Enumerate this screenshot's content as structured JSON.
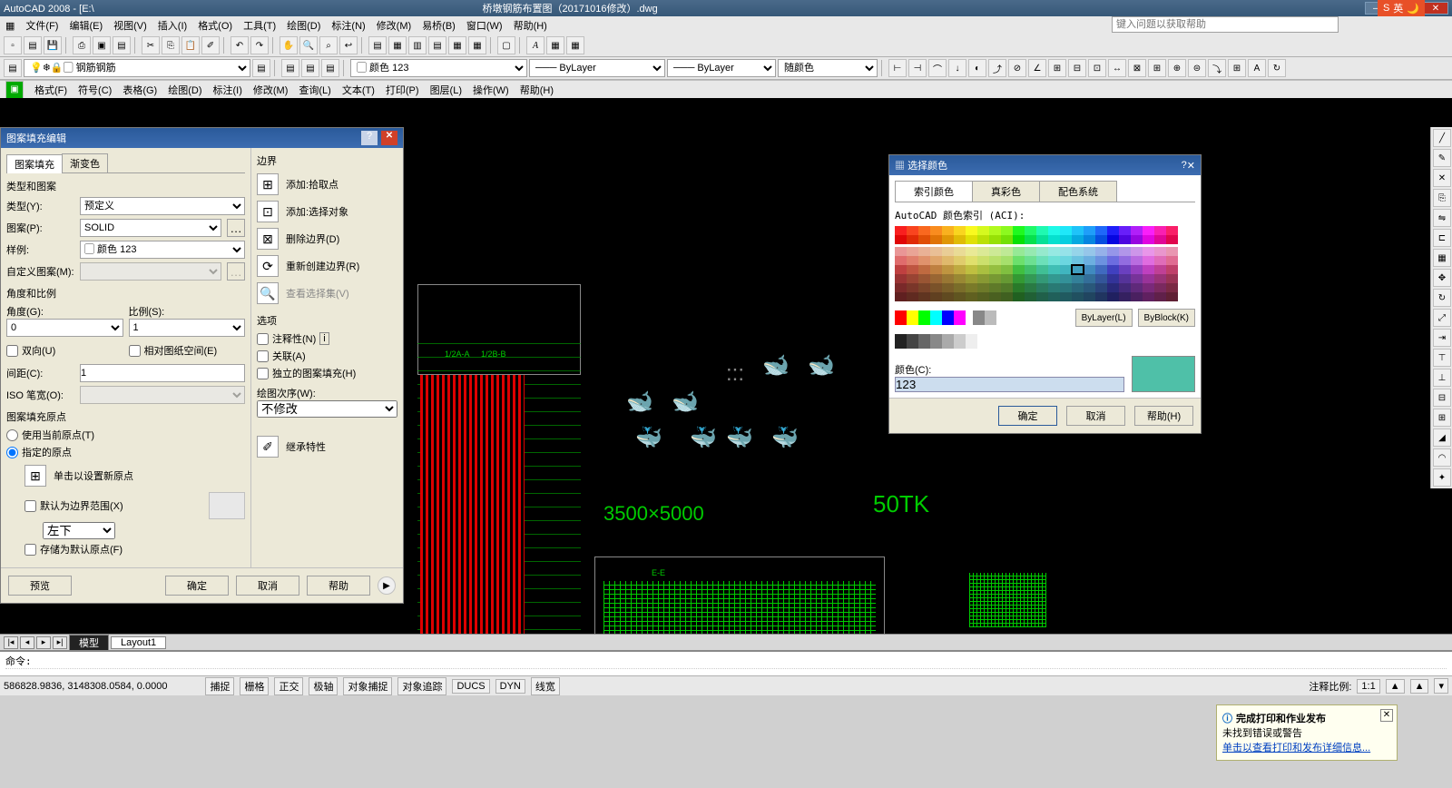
{
  "app": {
    "title": "AutoCAD 2008 - [E:\\",
    "doc": "桥墩钢筋布置图（20171016修改）.dwg"
  },
  "ime": {
    "text": "英"
  },
  "search_help": {
    "placeholder": "键入问题以获取帮助"
  },
  "menus": [
    "文件(F)",
    "编辑(E)",
    "视图(V)",
    "插入(I)",
    "格式(O)",
    "工具(T)",
    "绘图(D)",
    "标注(N)",
    "修改(M)",
    "易桥(B)",
    "窗口(W)",
    "帮助(H)"
  ],
  "menubar2": [
    "格式(F)",
    "符号(C)",
    "表格(G)",
    "绘图(D)",
    "标注(I)",
    "修改(M)",
    "查询(L)",
    "文本(T)",
    "打印(P)",
    "图层(L)",
    "操作(W)",
    "帮助(H)"
  ],
  "layer_props": {
    "layer": "钢筋",
    "color": "颜色 123",
    "ltype": "ByLayer",
    "lw": "ByLayer",
    "plot": "随颜色"
  },
  "hatch": {
    "title": "图案填充编辑",
    "tabs": [
      "图案填充",
      "渐变色"
    ],
    "type_label": "类型和图案",
    "type_l": "类型(Y):",
    "type_v": "预定义",
    "pattern_l": "图案(P):",
    "pattern_v": "SOLID",
    "sample_l": "样例:",
    "sample_v": "颜色 123",
    "custom_l": "自定义图案(M):",
    "angle_group": "角度和比例",
    "angle_l": "角度(G):",
    "angle_v": "0",
    "scale_l": "比例(S):",
    "scale_v": "1",
    "double": "双向(U)",
    "paperspace": "相对图纸空间(E)",
    "spacing_l": "间距(C):",
    "spacing_v": "1",
    "iso_l": "ISO 笔宽(O):",
    "origin_group": "图案填充原点",
    "origin_cur": "使用当前原点(T)",
    "origin_spec": "指定的原点",
    "origin_click": "单击以设置新原点",
    "origin_default": "默认为边界范围(X)",
    "origin_pos": "左下",
    "origin_store": "存储为默认原点(F)",
    "boundary_group": "边界",
    "b_pick": "添加:拾取点",
    "b_sel": "添加:选择对象",
    "b_rem": "删除边界(D)",
    "b_recreate": "重新创建边界(R)",
    "b_view": "查看选择集(V)",
    "options_group": "选项",
    "opt_ann": "注释性(N)",
    "opt_assoc": "关联(A)",
    "opt_sep": "独立的图案填充(H)",
    "draworder_l": "绘图次序(W):",
    "draworder_v": "不修改",
    "inherit": "继承特性",
    "preview": "预览",
    "ok": "确定",
    "cancel": "取消",
    "help": "帮助"
  },
  "colordlg": {
    "title": "选择颜色",
    "tabs": [
      "索引颜色",
      "真彩色",
      "配色系统"
    ],
    "aci_label": "AutoCAD 颜色索引 (ACI):",
    "bylayer": "ByLayer(L)",
    "byblock": "ByBlock(K)",
    "color_l": "颜色(C):",
    "color_v": "123",
    "ok": "确定",
    "cancel": "取消",
    "help": "帮助(H)"
  },
  "balloon": {
    "title": "完成打印和作业发布",
    "line1": "未找到错误或警告",
    "link": "单击以查看打印和发布详细信息..."
  },
  "cmdline": {
    "prompt": "命令:"
  },
  "sheets": {
    "active": "模型",
    "other": "Layout1"
  },
  "status": {
    "coords": "586828.9836, 3148308.0584, 0.0000",
    "buttons": [
      "捕捉",
      "栅格",
      "正交",
      "极轴",
      "对象捕捉",
      "对象追踪",
      "DUCS",
      "DYN",
      "线宽"
    ],
    "annoscale_l": "注释比例:",
    "annoscale_v": "1:1"
  },
  "drawing_text": {
    "dim": "3500×5000",
    "label": "50TK",
    "sec1": "1/2A-A",
    "sec2": "1/2B-B",
    "sec3": "E-E"
  }
}
